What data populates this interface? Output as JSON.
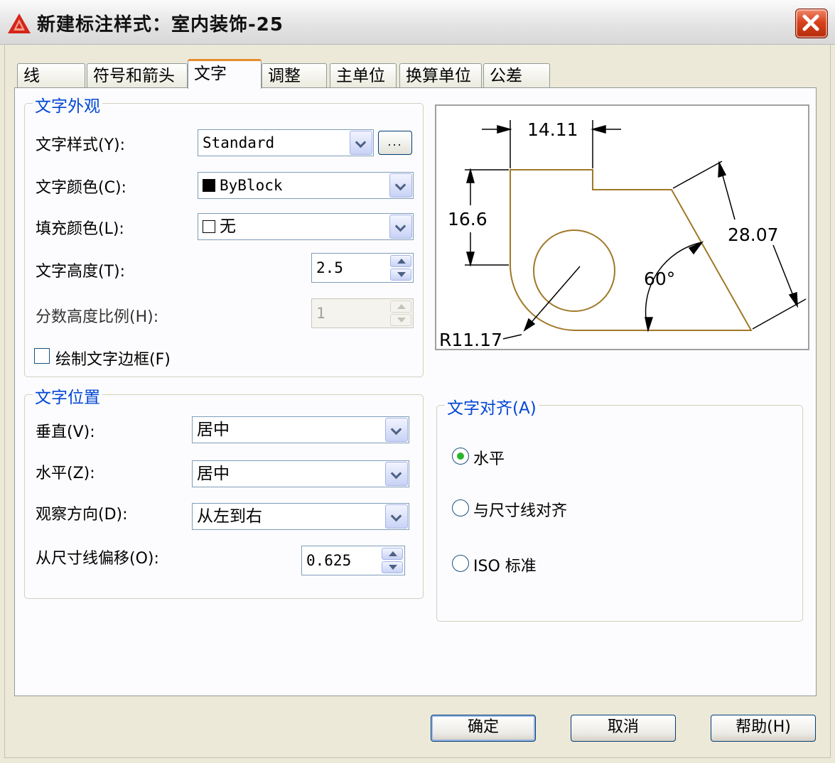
{
  "window": {
    "title": "新建标注样式：室内装饰-25"
  },
  "tabs": [
    "线",
    "符号和箭头",
    "文字",
    "调整",
    "主单位",
    "换算单位",
    "公差"
  ],
  "appearance": {
    "legend": "文字外观",
    "text_style_label": "文字样式(Y):",
    "text_style_value": "Standard",
    "ellipsis_label": "...",
    "text_color_label": "文字颜色(C):",
    "text_color_value": "ByBlock",
    "fill_color_label": "填充颜色(L):",
    "fill_color_value": "无",
    "text_height_label": "文字高度(T):",
    "text_height_value": "2.5",
    "fraction_scale_label": "分数高度比例(H):",
    "fraction_scale_value": "1",
    "draw_frame_label": "绘制文字边框(F)",
    "draw_frame_checked": false
  },
  "placement": {
    "legend": "文字位置",
    "vertical_label": "垂直(V):",
    "vertical_value": "居中",
    "horizontal_label": "水平(Z):",
    "horizontal_value": "居中",
    "view_direction_label": "观察方向(D):",
    "view_direction_value": "从左到右",
    "offset_label": "从尺寸线偏移(O):",
    "offset_value": "0.625"
  },
  "alignment": {
    "legend": "文字对齐(A)",
    "options": [
      "水平",
      "与尺寸线对齐",
      "ISO 标准"
    ],
    "selected": "水平"
  },
  "preview": {
    "dim_top": "14.11",
    "dim_left": "16.6",
    "dim_right": "28.07",
    "angle": "60°",
    "radius": "R11.17"
  },
  "buttons": {
    "ok": "确定",
    "cancel": "取消",
    "help": "帮助(H)"
  },
  "colors": {
    "accent": "#e68b2c",
    "legend": "#0046d5",
    "outline": "#a07828",
    "close": "#d8431e"
  }
}
